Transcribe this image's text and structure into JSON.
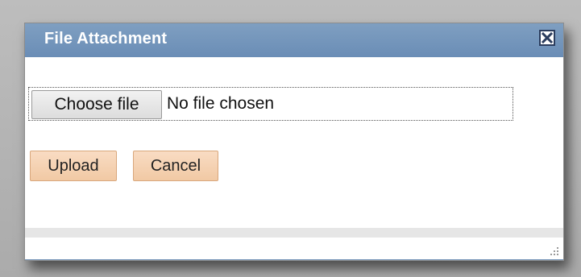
{
  "dialog": {
    "title": "File Attachment",
    "close_icon": "close-icon"
  },
  "file_input": {
    "button_label": "Choose file",
    "status_text": "No file chosen"
  },
  "actions": {
    "upload_label": "Upload",
    "cancel_label": "Cancel"
  },
  "colors": {
    "titlebar": "#7496bc",
    "title_text": "#ffffff",
    "action_button": "#f4cfae",
    "backdrop": "#b5b5b5"
  },
  "icons": {
    "close": "close-icon",
    "resize": "resize-grip-icon"
  }
}
